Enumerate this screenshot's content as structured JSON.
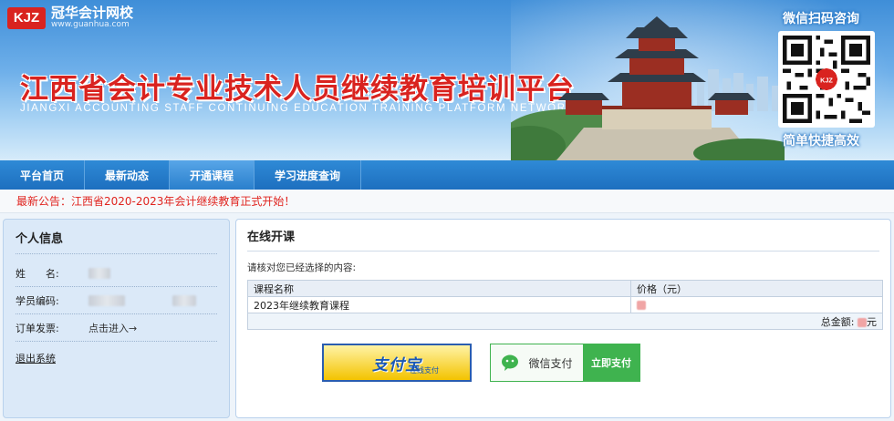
{
  "header": {
    "logo_mark": "KJZ",
    "logo_name": "冠华会计网校",
    "logo_url": "www.guanhua.com",
    "title": "江西省会计专业技术人员继续教育培训平台",
    "subtitle": "JIANGXI ACCOUNTING STAFF CONTINUING EDUCATION TRAINING PLATFORM NETWORK",
    "qr_title": "微信扫码咨询",
    "qr_badge": "KJZ",
    "qr_slogan": "简单快捷高效"
  },
  "nav": {
    "items": [
      {
        "label": "平台首页"
      },
      {
        "label": "最新动态"
      },
      {
        "label": "开通课程"
      },
      {
        "label": "学习进度查询"
      }
    ],
    "active_index": 2
  },
  "notice": {
    "text": "最新公告：江西省2020-2023年会计继续教育正式开始！"
  },
  "profile": {
    "title": "个人信息",
    "name_label": "姓　　名:",
    "id_label": "学员编码:",
    "invoice_label": "订单发票:",
    "invoice_link": "点击进入→",
    "logout": "退出系统"
  },
  "order": {
    "title": "在线开课",
    "hint": "请核对您已经选择的内容:",
    "columns": [
      "课程名称",
      "价格（元）"
    ],
    "rows": [
      {
        "course": "2023年继续教育课程"
      }
    ],
    "total_label": "总金额:",
    "total_unit": "元"
  },
  "payment": {
    "alipay_brand": "支付宝",
    "alipay_sub": "在线支付",
    "wechat_label": "微信支付",
    "wechat_action": "立即支付"
  },
  "colors": {
    "accent_blue": "#1d6fbf",
    "title_red": "#d9231f",
    "wechat_green": "#3fb34f",
    "alipay_yellow": "#f3c300"
  }
}
